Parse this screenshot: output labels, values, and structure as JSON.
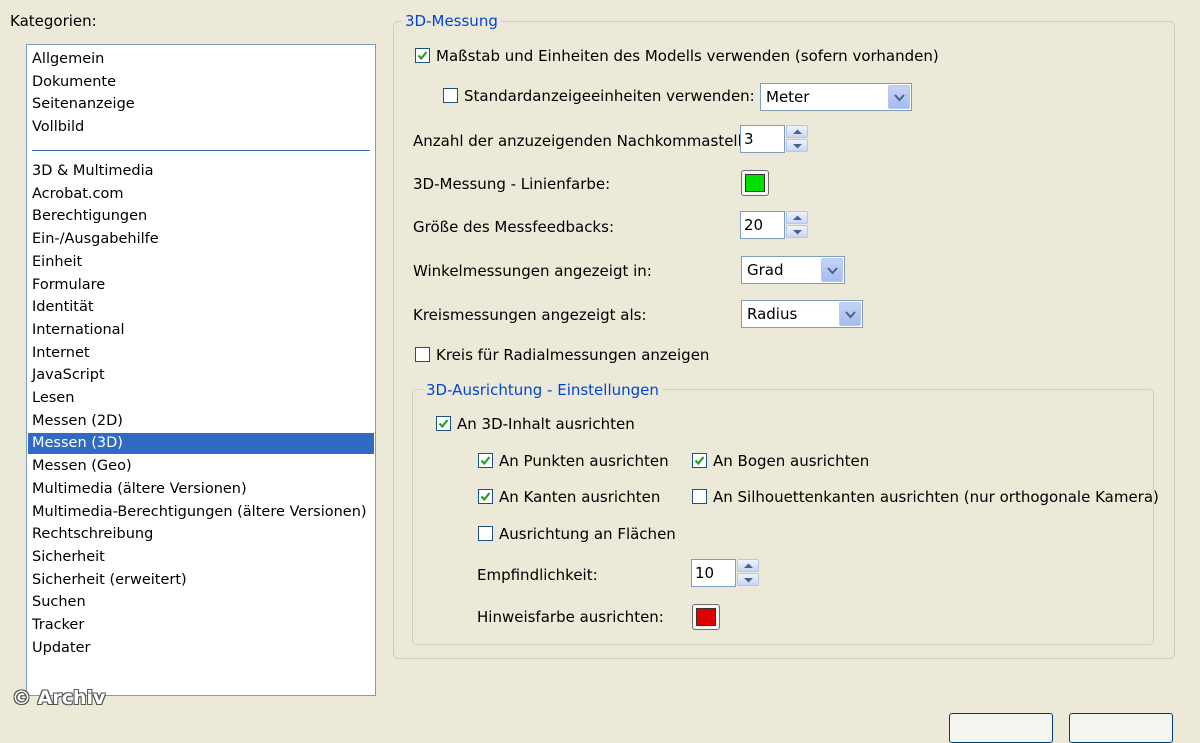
{
  "categories_label": "Kategorien:",
  "categories_top": [
    "Allgemein",
    "Dokumente",
    "Seitenanzeige",
    "Vollbild"
  ],
  "categories": [
    "3D & Multimedia",
    "Acrobat.com",
    "Berechtigungen",
    "Ein-/Ausgabehilfe",
    "Einheit",
    "Formulare",
    "Identität",
    "International",
    "Internet",
    "JavaScript",
    "Lesen",
    "Messen (2D)",
    "Messen (3D)",
    "Messen (Geo)",
    "Multimedia (ältere Versionen)",
    "Multimedia-Berechtigungen (ältere Versionen)",
    "Rechtschreibung",
    "Sicherheit",
    "Sicherheit (erweitert)",
    "Suchen",
    "Tracker",
    "Updater"
  ],
  "selected_category": "Messen (3D)",
  "measure": {
    "group_title": "3D-Messung",
    "use_model_scale": {
      "label": "Maßstab und Einheiten des Modells verwenden (sofern vorhanden)",
      "checked": true
    },
    "use_default_units": {
      "label": "Standardanzeigeeinheiten verwenden:",
      "checked": false
    },
    "units_value": "Meter",
    "decimals_label": "Anzahl der anzuzeigenden Nachkommastellen:",
    "decimals_value": "3",
    "line_color_label": "3D-Messung - Linienfarbe:",
    "line_color": "#00e000",
    "feedback_size_label": "Größe des Messfeedbacks:",
    "feedback_size_value": "20",
    "angle_label": "Winkelmessungen angezeigt in:",
    "angle_value": "Grad",
    "circle_label": "Kreismessungen angezeigt als:",
    "circle_value": "Radius",
    "radial_circle": {
      "label": "Kreis für Radialmessungen anzeigen",
      "checked": false
    }
  },
  "snap": {
    "group_title": "3D-Ausrichtung - Einstellungen",
    "snap_to_content": {
      "label": "An 3D-Inhalt ausrichten",
      "checked": true
    },
    "points": {
      "label": "An Punkten ausrichten",
      "checked": true
    },
    "arcs": {
      "label": "An Bogen ausrichten",
      "checked": true
    },
    "edges": {
      "label": "An Kanten ausrichten",
      "checked": true
    },
    "silhouette": {
      "label": "An Silhouettenkanten ausrichten (nur orthogonale Kamera)",
      "checked": false
    },
    "faces": {
      "label": "Ausrichtung an Flächen",
      "checked": false
    },
    "sensitivity_label": "Empfindlichkeit:",
    "sensitivity_value": "10",
    "hint_color_label": "Hinweisfarbe ausrichten:",
    "hint_color": "#e00000"
  },
  "watermark": "© Archiv"
}
